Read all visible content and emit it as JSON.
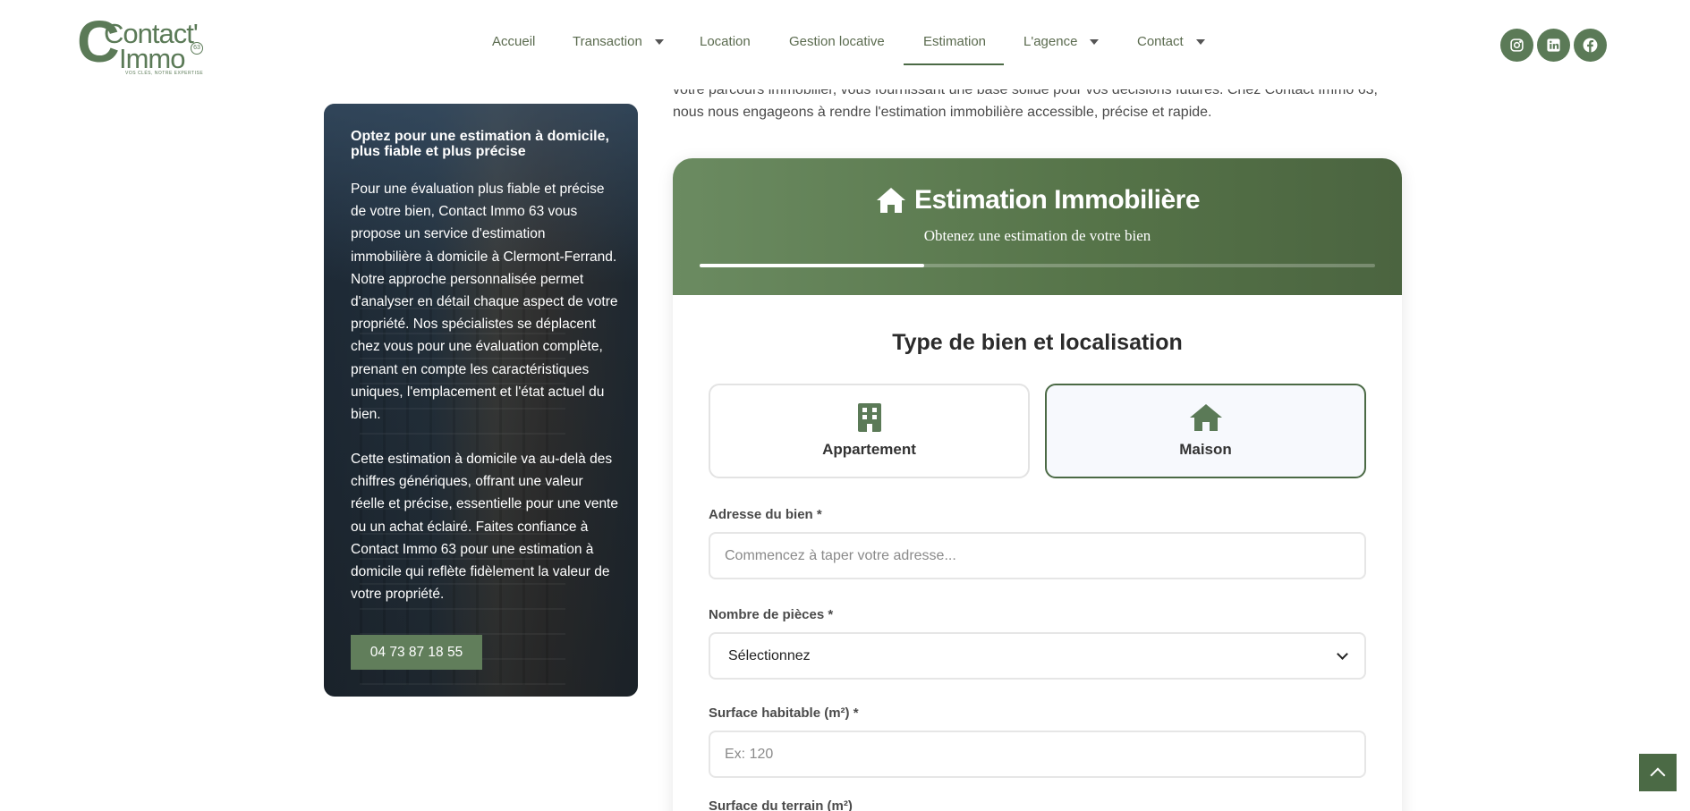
{
  "brand": {
    "logo_line1": "Contact'",
    "logo_line2": "Immo",
    "logo_badge": "63",
    "logo_tagline": "VOS CLÉS, NOTRE EXPERTISE",
    "accent": "#4b6a45",
    "primary": "#5b7a57"
  },
  "nav": {
    "items": [
      {
        "label": "Accueil"
      },
      {
        "label": "Transaction",
        "caret": true
      },
      {
        "label": "Location"
      },
      {
        "label": "Gestion locative"
      },
      {
        "label": "Estimation",
        "active": true
      },
      {
        "label": "L'agence",
        "caret": true
      },
      {
        "label": "Contact",
        "caret": true
      }
    ]
  },
  "socials": [
    {
      "icon": "instagram-icon"
    },
    {
      "icon": "linkedin-icon"
    },
    {
      "icon": "facebook-icon"
    }
  ],
  "intro": {
    "line1": "votre parcours immobilier, vous fournissant une base solide pour vos décisions futures. Chez Contact Immo 63,",
    "line2": "nous nous engageons à rendre l'estimation immobilière accessible, précise et rapide."
  },
  "sidebar": {
    "title": "Optez pour une estimation à domicile, plus fiable et plus précise",
    "paragraph1": "Pour une évaluation plus fiable et précise de votre bien, Contact Immo 63 vous propose un service d'estimation immobilière à domicile à Clermont-Ferrand. Notre approche personnalisée permet d'analyser en détail chaque aspect de votre propriété. Nos spécialistes se déplacent chez vous pour une évaluation complète, prenant en compte les caractéristiques uniques, l'emplacement et l'état actuel du bien.",
    "paragraph2": "Cette estimation à domicile va au-delà des chiffres génériques, offrant une valeur réelle et précise, essentielle pour une vente ou un achat éclairé. Faites confiance à Contact Immo 63 pour une estimation à domicile qui reflète fidèlement la valeur de votre propriété.",
    "phone_label": "04 73 87 18 55"
  },
  "estimation": {
    "title": "Estimation Immobilière",
    "subtitle": "Obtenez une estimation de votre bien",
    "progress": 0.333,
    "section_title": "Type de bien et localisation",
    "types": [
      {
        "label": "Appartement",
        "icon": "building-icon",
        "selected": false
      },
      {
        "label": "Maison",
        "icon": "house-icon",
        "selected": true
      }
    ],
    "fields": {
      "address_label": "Adresse du bien *",
      "address_placeholder": "Commencez à taper votre adresse...",
      "rooms_label": "Nombre de pièces *",
      "rooms_value": "Sélectionnez",
      "surface_label": "Surface habitable (m²) *",
      "surface_placeholder": "Ex: 120",
      "land_label": "Surface du terrain (m²)"
    }
  }
}
